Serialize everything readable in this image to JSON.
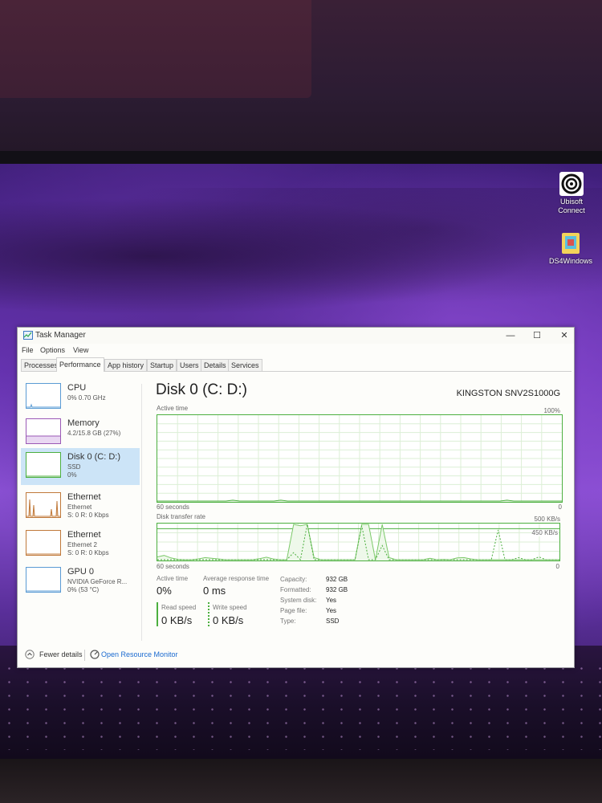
{
  "desktop": {
    "icons": [
      {
        "label_line1": "Ubisoft",
        "label_line2": "Connect",
        "icon": "ubisoft-connect-icon"
      },
      {
        "label_line1": "DS4Windows",
        "label_line2": "",
        "icon": "ds4windows-icon"
      }
    ]
  },
  "window": {
    "title": "Task Manager",
    "controls": {
      "minimize": "—",
      "maximize": "☐",
      "close": "✕"
    },
    "menu": [
      "File",
      "Options",
      "View"
    ],
    "tabs": [
      "Processes",
      "Performance",
      "App history",
      "Startup",
      "Users",
      "Details",
      "Services"
    ],
    "active_tab": "Performance"
  },
  "sidebar": {
    "items": [
      {
        "name": "CPU",
        "line1": "0% 0.70 GHz",
        "line2": ""
      },
      {
        "name": "Memory",
        "line1": "4.2/15.8 GB (27%)",
        "line2": ""
      },
      {
        "name": "Disk 0 (C: D:)",
        "line1": "SSD",
        "line2": "0%"
      },
      {
        "name": "Ethernet",
        "line1": "Ethernet",
        "line2": "S: 0 R: 0 Kbps"
      },
      {
        "name": "Ethernet",
        "line1": "Ethernet 2",
        "line2": "S: 0 R: 0 Kbps"
      },
      {
        "name": "GPU 0",
        "line1": "NVIDIA GeForce R...",
        "line2": "0% (53 °C)"
      }
    ],
    "selected_index": 2
  },
  "detail": {
    "title": "Disk 0 (C: D:)",
    "model": "KINGSTON SNV2S1000G",
    "active_time_graph": {
      "label": "Active time",
      "max": "100%",
      "xlabel": "60 seconds",
      "min": "0",
      "samples": [
        0,
        0,
        0,
        0,
        0,
        0,
        0,
        0,
        0,
        0,
        0,
        1,
        0,
        0,
        0,
        0,
        0,
        0,
        1,
        0,
        0,
        0,
        0,
        0,
        0,
        0,
        0,
        0,
        0,
        0,
        0,
        0,
        0,
        0,
        0,
        0,
        0,
        0,
        0,
        0,
        0,
        0,
        0,
        0,
        0,
        0,
        0,
        0,
        0,
        0,
        0,
        1,
        0,
        0,
        0,
        0,
        0,
        0,
        0,
        0
      ]
    },
    "transfer_graph": {
      "label": "Disk transfer rate",
      "max": "500 KB/s",
      "ref_line": "450 KB/s",
      "xlabel": "60 seconds",
      "min": "0",
      "read_series": [
        40,
        60,
        25,
        5,
        0,
        0,
        10,
        30,
        20,
        10,
        0,
        0,
        0,
        0,
        0,
        15,
        35,
        10,
        0,
        0,
        500,
        480,
        500,
        30,
        0,
        0,
        0,
        0,
        0,
        0,
        500,
        500,
        0,
        500,
        30,
        0,
        0,
        0,
        0,
        0,
        20,
        0,
        5,
        0,
        25,
        30,
        10,
        0,
        0,
        0,
        0,
        0,
        0,
        0,
        0,
        0,
        0,
        0,
        0,
        0
      ],
      "write_series": [
        0,
        0,
        0,
        0,
        0,
        0,
        0,
        0,
        0,
        0,
        0,
        0,
        0,
        0,
        0,
        0,
        0,
        0,
        0,
        0,
        100,
        0,
        500,
        0,
        0,
        0,
        0,
        0,
        0,
        0,
        480,
        0,
        0,
        200,
        0,
        0,
        0,
        0,
        0,
        0,
        0,
        0,
        0,
        0,
        0,
        0,
        0,
        0,
        0,
        0,
        420,
        0,
        0,
        30,
        0,
        0,
        40,
        0,
        0,
        0
      ]
    },
    "stats": {
      "active_time_label": "Active time",
      "active_time_value": "0%",
      "response_label": "Average response time",
      "response_value": "0 ms",
      "read_label": "Read speed",
      "read_value": "0 KB/s",
      "write_label": "Write speed",
      "write_value": "0 KB/s"
    },
    "properties": [
      {
        "key": "Capacity:",
        "value": "932 GB"
      },
      {
        "key": "Formatted:",
        "value": "932 GB"
      },
      {
        "key": "System disk:",
        "value": "Yes"
      },
      {
        "key": "Page file:",
        "value": "Yes"
      },
      {
        "key": "Type:",
        "value": "SSD"
      }
    ]
  },
  "footer": {
    "fewer_details": "Fewer details",
    "open_resource_monitor": "Open Resource Monitor"
  },
  "colors": {
    "accent_green": "#4caf3f",
    "link_blue": "#1a6ad0",
    "selected_bg": "#cce4f7"
  }
}
